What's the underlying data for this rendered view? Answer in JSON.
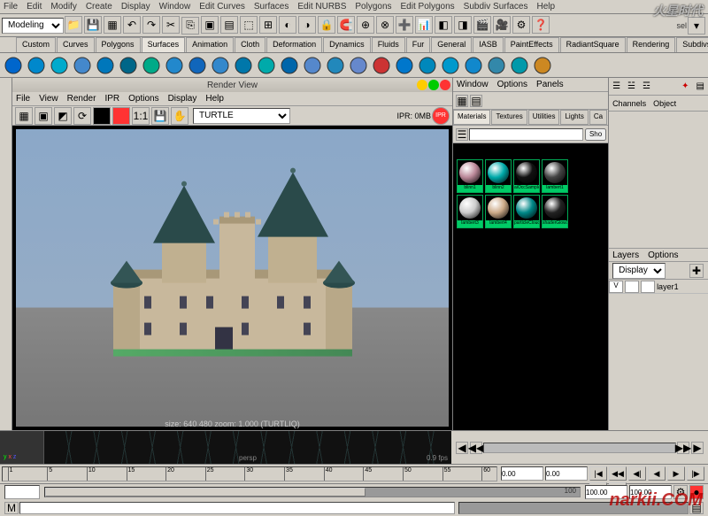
{
  "menubar": [
    "File",
    "Edit",
    "Modify",
    "Create",
    "Display",
    "Window",
    "Edit Curves",
    "Surfaces",
    "Edit NURBS",
    "Polygons",
    "Edit Polygons",
    "Subdiv Surfaces",
    "Help"
  ],
  "mode_combo": "Modeling",
  "sel_label": "sel",
  "shelf_tabs": [
    "Custom",
    "Curves",
    "Polygons",
    "Surfaces",
    "Animation",
    "Cloth",
    "Deformation",
    "Dynamics",
    "Fluids",
    "Fur",
    "General",
    "IASB",
    "PaintEffects",
    "RadiantSquare",
    "Rendering",
    "Subdivs"
  ],
  "shelf_active": 3,
  "render_view": {
    "title": "Render View",
    "menu": [
      "File",
      "View",
      "Render",
      "IPR",
      "Options",
      "Display",
      "Help"
    ],
    "renderer_combo": "TURTLE",
    "ipr_label": "IPR: 0MB",
    "status": "size: 640  480  zoom: 1.000  (TURTLIQ)"
  },
  "hypershade": {
    "menu": [
      "Window",
      "Options",
      "Panels"
    ],
    "tabs": [
      "Materials",
      "Textures",
      "Utilities",
      "Lights",
      "Ca"
    ],
    "search_btn": "Sho",
    "swatches": [
      "blinn1",
      "blinn2",
      "aiOccSampler5",
      "lambert1",
      "lambert3",
      "lambert4",
      "particleCloud1",
      "shaderGlow1"
    ]
  },
  "channel_box": {
    "tabs": [
      "Channels",
      "Object"
    ],
    "layers_menu": [
      "Layers",
      "Options"
    ],
    "display_combo": "Display",
    "layer_vis": "V",
    "layer_name": "layer1"
  },
  "viewport": {
    "label": "persp",
    "fps": "0.9 fps",
    "axis_x": "x",
    "axis_y": "y",
    "axis_z": "z"
  },
  "timeline": {
    "ticks": [
      "1",
      "5",
      "10",
      "15",
      "20",
      "25",
      "30",
      "35",
      "40",
      "45",
      "50",
      "55",
      "60"
    ],
    "start1": "0.00",
    "start2": "0.00",
    "end1": "100.00",
    "end2": "100.00",
    "range_end": "100"
  },
  "playback_icons": [
    "|◀",
    "◀◀",
    "◀|",
    "◀",
    "▶",
    "|▶",
    "▶▶",
    "▶|"
  ],
  "watermark": "narkii.COM"
}
